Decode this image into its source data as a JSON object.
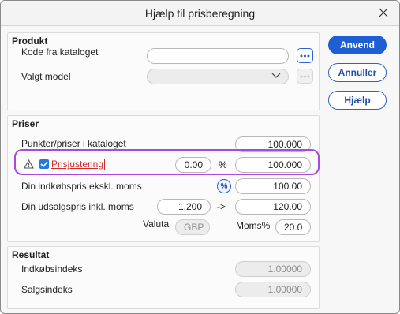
{
  "window": {
    "title": "Hjælp til prisberegning"
  },
  "buttons": {
    "apply": "Anvend",
    "cancel": "Annuller",
    "help": "Hjælp"
  },
  "product": {
    "group_title": "Produkt",
    "catalog_code_label": "Kode fra kataloget",
    "catalog_code_value": "",
    "model_label": "Valgt model",
    "model_value": ""
  },
  "prices": {
    "group_title": "Priser",
    "catalog_points_label": "Punkter/priser i kataloget",
    "catalog_points_value": "100.000",
    "adjustment_label": "Prisjustering",
    "adjustment_checked": true,
    "adjustment_percent": "0.00",
    "percent_symbol": "%",
    "adjustment_value": "100.000",
    "purchase_label": "Din indkøbspris ekskl. moms",
    "percent_toggle": "%",
    "purchase_value": "100.00",
    "sales_label": "Din udsalgspris inkl. moms",
    "sales_factor": "1.200",
    "arrow": "->",
    "sales_value": "120.00",
    "currency_label": "Valuta",
    "currency_value": "GBP",
    "vat_label": "Moms%",
    "vat_value": "20.0"
  },
  "result": {
    "group_title": "Resultat",
    "purchase_index_label": "Indkøbsindeks",
    "purchase_index_value": "1.00000",
    "sales_index_label": "Salgsindeks",
    "sales_index_value": "1.00000"
  },
  "colors": {
    "accent": "#1e5fd3",
    "highlight": "#a64be0",
    "warning": "#d62828"
  }
}
